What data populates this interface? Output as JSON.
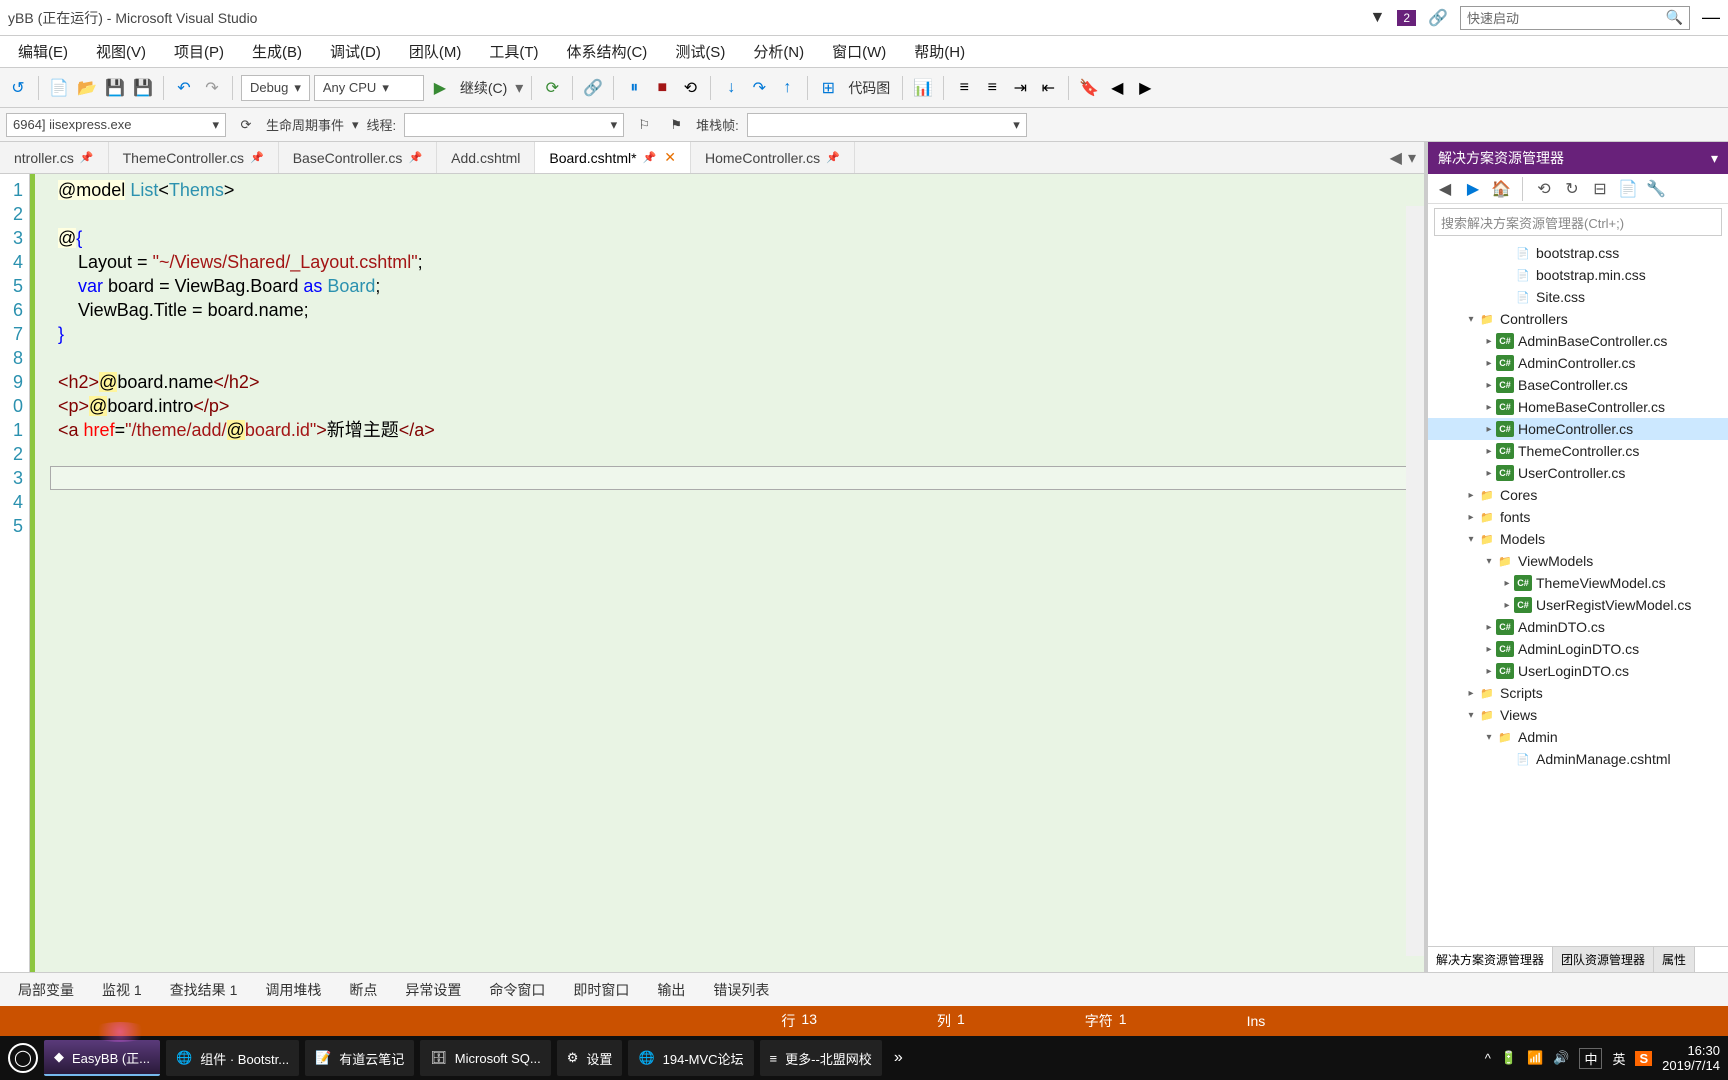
{
  "title_bar": {
    "title": "yBB (正在运行) - Microsoft Visual Studio",
    "filter_count": "2",
    "quick_launch_placeholder": "快速启动"
  },
  "menu": [
    "编辑(E)",
    "视图(V)",
    "项目(P)",
    "生成(B)",
    "调试(D)",
    "团队(M)",
    "工具(T)",
    "体系结构(C)",
    "测试(S)",
    "分析(N)",
    "窗口(W)",
    "帮助(H)"
  ],
  "toolbar": {
    "config": "Debug",
    "platform": "Any CPU",
    "continue": "继续(C)",
    "codemap": "代码图"
  },
  "toolbar2": {
    "process": "6964] iisexpress.exe",
    "lifecycle_label": "生命周期事件",
    "thread_label": "线程:",
    "stackframe_label": "堆栈帧:"
  },
  "tabs": [
    {
      "label": "ntroller.cs",
      "pinned": true,
      "active": false
    },
    {
      "label": "ThemeController.cs",
      "pinned": true,
      "active": false
    },
    {
      "label": "BaseController.cs",
      "pinned": true,
      "active": false
    },
    {
      "label": "Add.cshtml",
      "pinned": false,
      "active": false
    },
    {
      "label": "Board.cshtml",
      "pinned": true,
      "active": true,
      "modified": true
    },
    {
      "label": "HomeController.cs",
      "pinned": true,
      "active": false
    }
  ],
  "code": {
    "line_numbers": [
      "1",
      "2",
      "3",
      "4",
      "5",
      "6",
      "7",
      "8",
      "9",
      "0",
      "1",
      "2",
      "3",
      "4",
      "5"
    ],
    "lines_html": [
      "<span class='at'>@model</span> <span class='ty'>List</span>&lt;<span class='ty'>Thems</span>&gt;",
      "",
      "<span class='at'>@</span><span class='kw'>{</span>",
      "    Layout = <span class='str'>\"~/Views/Shared/_Layout.cshtml\"</span>;",
      "    <span class='kw'>var</span> board = ViewBag.Board <span class='kw'>as</span> <span class='ty'>Board</span>;",
      "    ViewBag.Title = board.name;",
      "<span class='kw'>}</span>",
      "",
      "<span class='tag'>&lt;h2&gt;</span><span class='hl'>@</span>board.name<span class='tag'>&lt;/h2&gt;</span>",
      "<span class='tag'>&lt;p&gt;</span><span class='hl'>@</span>board.intro<span class='tag'>&lt;/p&gt;</span>",
      "<span class='tag'>&lt;a</span> <span class='attr'>href</span>=<span class='str'>\"/theme/add/</span><span class='hl'>@</span><span class='str'>board.id\"</span><span class='tag'>&gt;</span>新增主题<span class='tag'>&lt;/a&gt;</span>",
      "",
      "",
      "",
      ""
    ],
    "cursor_line_index": 12
  },
  "solution": {
    "title": "解决方案资源管理器",
    "search_placeholder": "搜索解决方案资源管理器(Ctrl+;)",
    "tree": [
      {
        "depth": 4,
        "icon": "css",
        "label": "bootstrap.css"
      },
      {
        "depth": 4,
        "icon": "css",
        "label": "bootstrap.min.css"
      },
      {
        "depth": 4,
        "icon": "css",
        "label": "Site.css"
      },
      {
        "depth": 2,
        "icon": "folder",
        "label": "Controllers",
        "arrow": "▾"
      },
      {
        "depth": 3,
        "icon": "cs",
        "label": "AdminBaseController.cs",
        "arrow": "▸"
      },
      {
        "depth": 3,
        "icon": "cs",
        "label": "AdminController.cs",
        "arrow": "▸"
      },
      {
        "depth": 3,
        "icon": "cs",
        "label": "BaseController.cs",
        "arrow": "▸"
      },
      {
        "depth": 3,
        "icon": "cs",
        "label": "HomeBaseController.cs",
        "arrow": "▸"
      },
      {
        "depth": 3,
        "icon": "cs",
        "label": "HomeController.cs",
        "arrow": "▸",
        "selected": true
      },
      {
        "depth": 3,
        "icon": "cs",
        "label": "ThemeController.cs",
        "arrow": "▸"
      },
      {
        "depth": 3,
        "icon": "cs",
        "label": "UserController.cs",
        "arrow": "▸"
      },
      {
        "depth": 2,
        "icon": "folder",
        "label": "Cores",
        "arrow": "▸"
      },
      {
        "depth": 2,
        "icon": "folder",
        "label": "fonts",
        "arrow": "▸"
      },
      {
        "depth": 2,
        "icon": "folder",
        "label": "Models",
        "arrow": "▾"
      },
      {
        "depth": 3,
        "icon": "folder",
        "label": "ViewModels",
        "arrow": "▾"
      },
      {
        "depth": 4,
        "icon": "cs",
        "label": "ThemeViewModel.cs",
        "arrow": "▸"
      },
      {
        "depth": 4,
        "icon": "cs",
        "label": "UserRegistViewModel.cs",
        "arrow": "▸"
      },
      {
        "depth": 3,
        "icon": "cs",
        "label": "AdminDTO.cs",
        "arrow": "▸"
      },
      {
        "depth": 3,
        "icon": "cs",
        "label": "AdminLoginDTO.cs",
        "arrow": "▸"
      },
      {
        "depth": 3,
        "icon": "cs",
        "label": "UserLoginDTO.cs",
        "arrow": "▸"
      },
      {
        "depth": 2,
        "icon": "folder",
        "label": "Scripts",
        "arrow": "▸"
      },
      {
        "depth": 2,
        "icon": "folder",
        "label": "Views",
        "arrow": "▾"
      },
      {
        "depth": 3,
        "icon": "folder",
        "label": "Admin",
        "arrow": "▾"
      },
      {
        "depth": 4,
        "icon": "cshtml",
        "label": "AdminManage.cshtml"
      }
    ],
    "bottom_tabs": [
      "解决方案资源管理器",
      "团队资源管理器",
      "属性"
    ]
  },
  "bottom_tabs": [
    "局部变量",
    "监视 1",
    "查找结果 1",
    "调用堆栈",
    "断点",
    "异常设置",
    "命令窗口",
    "即时窗口",
    "输出",
    "错误列表"
  ],
  "status": {
    "line_label": "行",
    "line_val": "13",
    "col_label": "列",
    "col_val": "1",
    "char_label": "字符",
    "char_val": "1",
    "ins": "Ins"
  },
  "taskbar": {
    "items": [
      {
        "icon": "vs",
        "label": "EasyBB (正..."
      },
      {
        "icon": "chrome",
        "label": "组件 · Bootstr..."
      },
      {
        "icon": "youdao",
        "label": "有道云笔记"
      },
      {
        "icon": "sqlserver",
        "label": "Microsoft SQ..."
      },
      {
        "icon": "settings",
        "label": "设置"
      },
      {
        "icon": "edge",
        "label": "194-MVC论坛"
      },
      {
        "icon": "text",
        "label": "更多--北盟网校"
      }
    ],
    "ime1": "中",
    "ime2": "英",
    "time": "16:30",
    "date": "2019/7/14"
  }
}
